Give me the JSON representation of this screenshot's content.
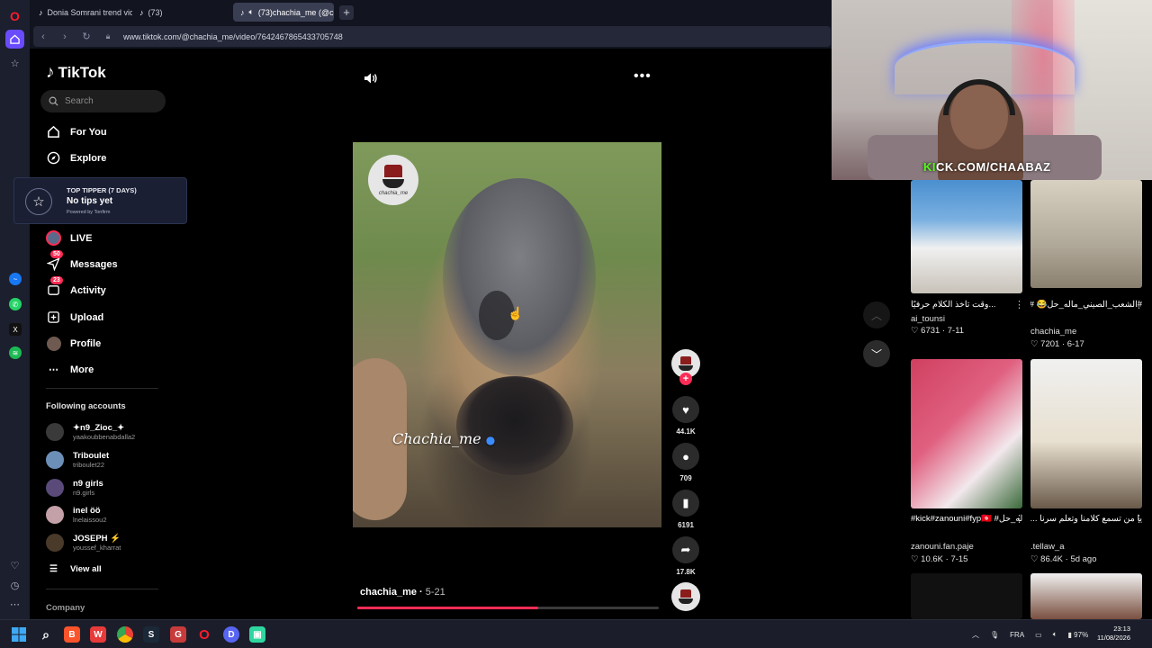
{
  "browser": {
    "tabs": [
      {
        "label": "Donia Somrani trend vide…",
        "active": false
      },
      {
        "label": "(73)",
        "active": false
      },
      {
        "label": "(73)chachia_me (@ch…",
        "active": true
      }
    ],
    "new_tab_label": "+",
    "url": "www.tiktok.com/@chachia_me/video/7642467865433705748"
  },
  "tiktok": {
    "logo": "TikTok",
    "search_placeholder": "Search",
    "nav": {
      "for_you": "For You",
      "explore": "Explore",
      "live": "LIVE",
      "messages": "Messages",
      "messages_badge": "50",
      "activity": "Activity",
      "activity_badge": "23",
      "upload": "Upload",
      "profile": "Profile",
      "more": "More"
    },
    "tipper": {
      "title": "TOP TIPPER (7 DAYS)",
      "value": "No tips yet",
      "powered": "Powered by Tonfirm"
    },
    "following_title": "Following accounts",
    "following": [
      {
        "name": "✦n9_Zioc_✦",
        "handle": "yaakoubbenabdalla2",
        "color": "#3a3a3a"
      },
      {
        "name": "Triboulet",
        "handle": "triboulet22",
        "color": "#6c8fb8"
      },
      {
        "name": "n9 girls",
        "handle": "n9.girls",
        "color": "#5a4a7a"
      },
      {
        "name": "inel öö",
        "handle": "lnelaissou2",
        "color": "#c4a0a8"
      },
      {
        "name": "JOSEPH ⚡",
        "handle": "youssef_kharrat",
        "color": "#4a3a2a"
      }
    ],
    "view_all": "View all",
    "company": "Company"
  },
  "video": {
    "overlay_name": "Chachia_me",
    "avatar_label": "chachia_me",
    "author": "chachia_me",
    "date": "5-21",
    "progress_fraction": 0.6,
    "likes": "44.1K",
    "comments": "709",
    "saves": "6191",
    "shares": "17.8K",
    "follow_plus": "+"
  },
  "recommendations": [
    {
      "caption": "...وقت تاخذ الكلام حرفيًا",
      "user": "ai_tounsi",
      "likes": "6731",
      "date": "7-11",
      "colors": [
        "#4a8fd0",
        "#f0f0f0",
        "#c8c2b8"
      ]
    },
    {
      "caption": "#الشعب_الصيني_ماله_حل😂 #هاك_توك #مونتاجي 😂 🎬",
      "user": "chachia_me",
      "likes": "7201",
      "date": "6-17",
      "colors": [
        "#d8d0c0",
        "#b0a898",
        "#8a8070"
      ]
    },
    {
      "caption": "#kick#zanouni#fyp🇹🇳 #الشعب_الصيني_ماله_حل😂...",
      "user": "zanouni.fan.paje",
      "likes": "10.6K",
      "date": "7-15",
      "colors": [
        "#d04060",
        "#e06080",
        "#3a6a3a"
      ]
    },
    {
      "caption": "يا من تسمع كلامنا وتعلم سرنا ... سبحانه || #ماهر_المعيقلي",
      "user": ".tellaw_a",
      "likes": "86.4K",
      "date": "5d ago",
      "colors": [
        "#f0f0f0",
        "#e8e0d0",
        "#6a5a4a"
      ]
    }
  ],
  "webcam": {
    "brand_prefix": "KI",
    "brand_rest": "CK.COM/CHAABAZ"
  },
  "taskbar": {
    "lang": "FRA",
    "battery": "97%",
    "time": "23:13",
    "date": "11/08/2026"
  }
}
